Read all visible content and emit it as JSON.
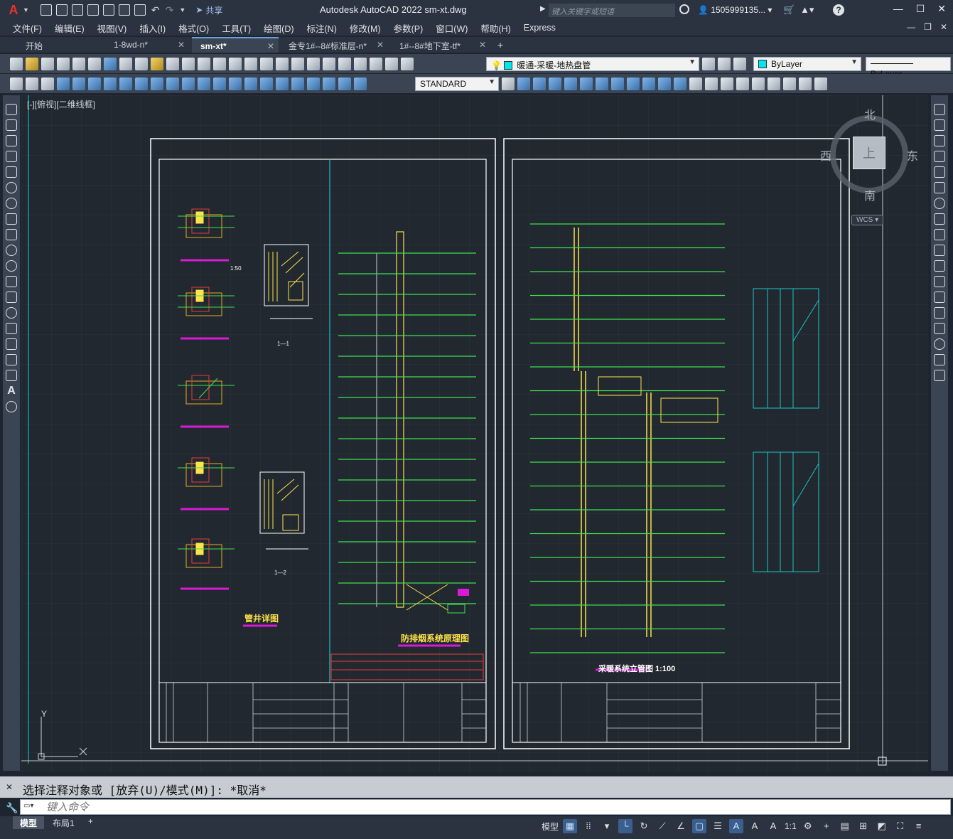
{
  "titlebar": {
    "app_title": "Autodesk AutoCAD 2022    sm-xt.dwg",
    "share_label": "共享",
    "search_placeholder": "键入关键字或短语",
    "user_name": "1505999135..."
  },
  "menu": {
    "items": [
      "文件(F)",
      "编辑(E)",
      "视图(V)",
      "插入(I)",
      "格式(O)",
      "工具(T)",
      "绘图(D)",
      "标注(N)",
      "修改(M)",
      "参数(P)",
      "窗口(W)",
      "帮助(H)",
      "Express"
    ]
  },
  "tabs": [
    {
      "label": "开始",
      "active": false,
      "closable": false
    },
    {
      "label": "1-8wd-n*",
      "active": false,
      "closable": true
    },
    {
      "label": "sm-xt*",
      "active": true,
      "closable": true
    },
    {
      "label": "金专1#--8#标准层-n*",
      "active": false,
      "closable": true
    },
    {
      "label": "1#--8#地下室-tf*",
      "active": false,
      "closable": true
    }
  ],
  "toolbar": {
    "layer_name": "暖通-采暖-地热盘管",
    "color_value": "ByLayer",
    "linetype_value": "ByLayer",
    "text_style": "STANDARD"
  },
  "viewport": {
    "label": "[-][俯视][二维线框]",
    "viewcube": {
      "north": "北",
      "south": "南",
      "west": "西",
      "east": "东",
      "face": "上"
    },
    "wcs": "WCS"
  },
  "drawing": {
    "left_sheet": {
      "detail_caption_1": "管井详图",
      "detail_caption_2": "防排烟系统原理图",
      "scale_1": "1:50",
      "section_1": "1—1",
      "section_2": "1—2"
    },
    "right_sheet": {
      "caption": "采暖系统立管图 1:100"
    },
    "ucs": {
      "x": "X",
      "y": "Y"
    }
  },
  "command": {
    "history": "选择注释对象或 [放弃(U)/模式(M)]: *取消*",
    "input_placeholder": "键入命令"
  },
  "statusbar": {
    "layout_tabs": [
      "模型",
      "布局1"
    ],
    "model_label": "模型",
    "scale_label": "1:1"
  }
}
